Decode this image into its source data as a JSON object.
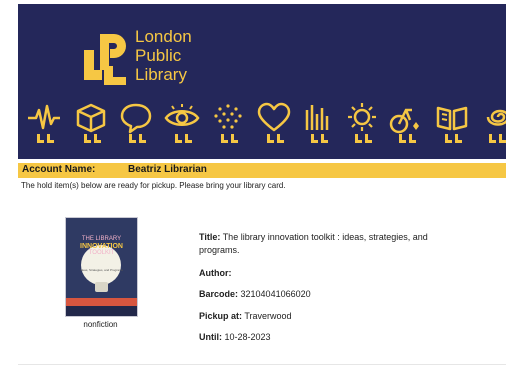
{
  "library": {
    "name_line1": "London",
    "name_line2": "Public",
    "name_line3": "Library",
    "brand_dark": "#24275a",
    "brand_yellow": "#f6c744"
  },
  "icons": [
    "heartbeat-icon",
    "cube-icon",
    "speech-bubble-icon",
    "eye-icon",
    "sparkle-dots-icon",
    "heart-icon",
    "city-skyline-icon",
    "sun-icon",
    "bicycle-icon",
    "open-book-icon",
    "swirl-icon"
  ],
  "account": {
    "label": "Account Name:",
    "name": "Beatriz Librarian"
  },
  "notice": "The hold item(s) below are ready for pickup.  Please bring your library card.",
  "item": {
    "cover": {
      "title_line1": "THE LIBRARY",
      "title_line2": "INNOVATION",
      "title_line3": "TOOLKIT",
      "subtitle": "Ideas, Strategies, and Programs"
    },
    "genre": "nonfiction",
    "title_label": "Title:",
    "title_line1": "The library innovation toolkit : ideas, strategies, and",
    "title_line2": "programs.",
    "author_label": "Author:",
    "author_value": "",
    "barcode_label": "Barcode:",
    "barcode_value": "32104041066020",
    "pickup_label": "Pickup at:",
    "pickup_value": "Traverwood",
    "until_label": "Until:",
    "until_value": "10-28-2023"
  }
}
